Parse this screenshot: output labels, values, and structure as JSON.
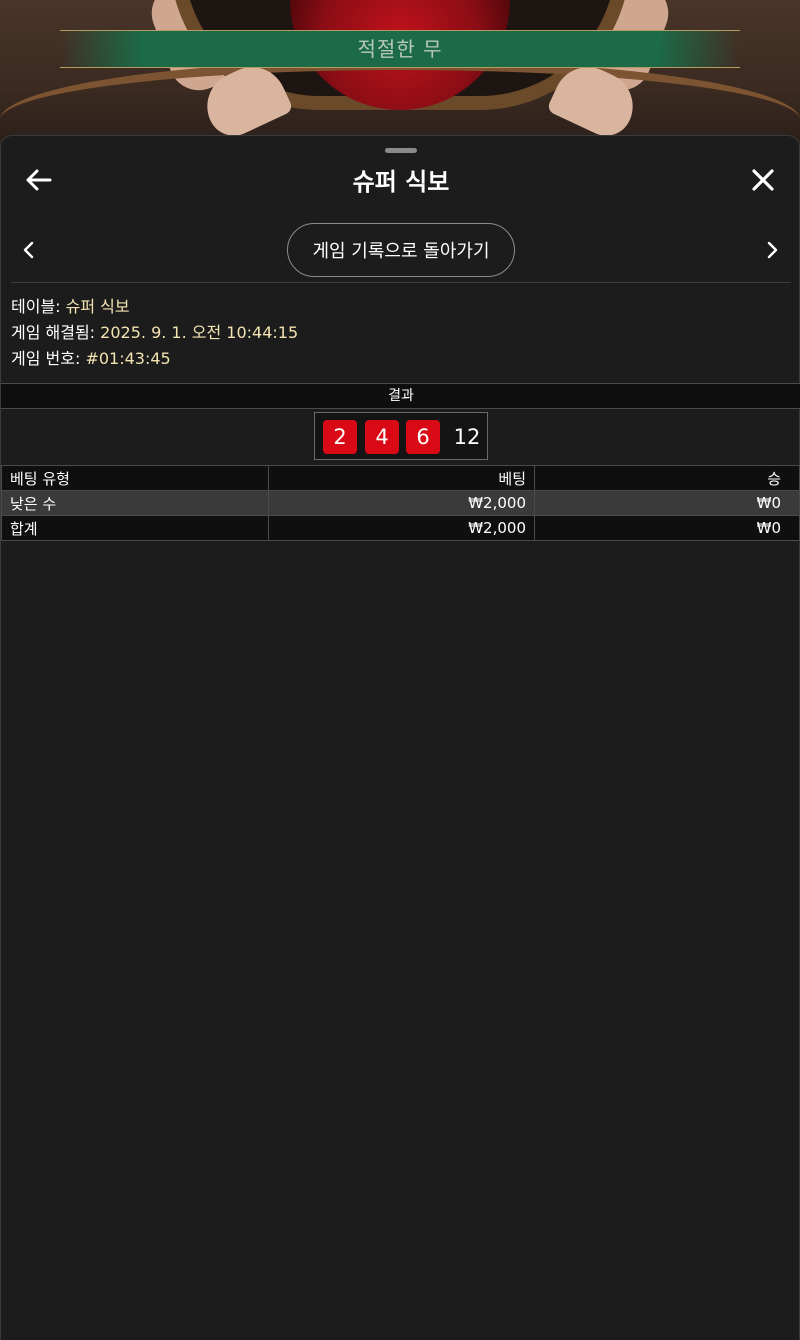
{
  "video": {
    "banner_text": "적절한 무"
  },
  "sheet": {
    "title": "슈퍼 식보",
    "back_icon": "arrow-left-icon",
    "close_icon": "close-icon",
    "history_button_label": "게임 기록으로 돌아가기",
    "prev_icon": "chevron-left-icon",
    "next_icon": "chevron-right-icon"
  },
  "info": {
    "table_label": "테이블:",
    "table_value": "슈퍼 식보",
    "resolved_label": "게임 해결됨:",
    "resolved_value": "2025. 9. 1. 오전 10:44:15",
    "game_no_label": "게임 번호:",
    "game_no_value": "#01:43:45"
  },
  "result": {
    "header": "결과",
    "dice": [
      "2",
      "4",
      "6"
    ],
    "total": "12",
    "dice_color": "#d90a16"
  },
  "bets_table": {
    "headers": [
      "베팅 유형",
      "베팅",
      "승"
    ],
    "rows": [
      {
        "type": "낮은 수",
        "bet": "₩2,000",
        "win": "₩0"
      }
    ],
    "total": {
      "type": "합계",
      "bet": "₩2,000",
      "win": "₩0"
    }
  },
  "colors": {
    "background": "#1c1c1c",
    "accent_text": "#f3e3b0",
    "banner": "#1c6a48"
  }
}
